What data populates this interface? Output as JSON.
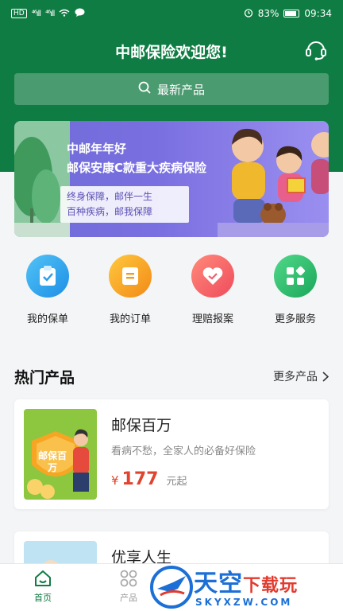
{
  "status": {
    "signal1": "⁴⁶ıll",
    "signal2": "⁴⁶ıll",
    "battery": "83%",
    "time": "09:34"
  },
  "header": {
    "title": "中邮保险欢迎您!"
  },
  "search": {
    "placeholder": "最新产品"
  },
  "banner": {
    "headline1": "中邮年年好",
    "headline2": "邮保安康C款重大疾病保险",
    "sub1": "终身保障，邮伴一生",
    "sub2": "百种疾病，邮我保障"
  },
  "quick": [
    {
      "label": "我的保单",
      "icon": "policy-icon"
    },
    {
      "label": "我的订单",
      "icon": "order-icon"
    },
    {
      "label": "理赔报案",
      "icon": "claim-icon"
    },
    {
      "label": "更多服务",
      "icon": "more-services-icon"
    }
  ],
  "hot": {
    "title": "热门产品",
    "more": "更多产品"
  },
  "products": [
    {
      "name": "邮保百万",
      "desc": "看病不愁，全家人的必备好保险",
      "currency": "¥",
      "price": "177",
      "unit": "元起",
      "thumb_text": "邮保百万"
    },
    {
      "name": "优享人生"
    }
  ],
  "tabs": [
    {
      "label": "首页",
      "icon": "home-icon"
    },
    {
      "label": "产品",
      "icon": "grid-icon"
    }
  ],
  "watermark": {
    "big": "天空",
    "small": "下载玩",
    "url": "SKYXZW.COM"
  },
  "colors": {
    "brand_green": "#0f7d43",
    "price_red": "#e1442d"
  }
}
